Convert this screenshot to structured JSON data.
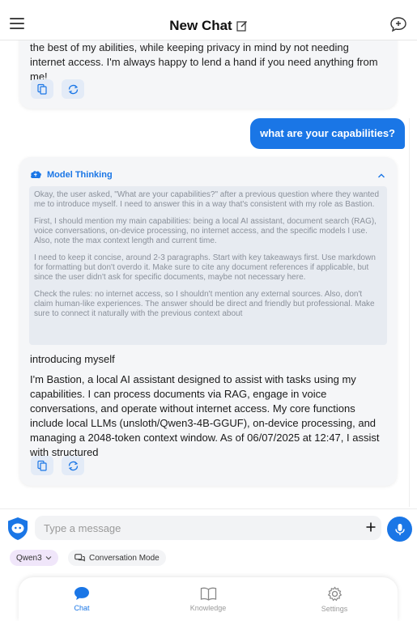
{
  "header": {
    "title": "New Chat"
  },
  "chat": {
    "previous_message": "the best of my abilities, while keeping privacy in mind by not needing internet access. I'm always happy to lend a hand if you need anything from me!",
    "user_message": "what are your capabilities?",
    "thinking": {
      "label": "Model Thinking",
      "paragraphs": [
        "Okay, the user asked, \"What are your capabilities?\" after a previous question where they wanted me to introduce myself. I need to answer this in a way that's consistent with my role as Bastion.",
        "First, I should mention my main capabilities: being a local AI assistant, document search (RAG), voice conversations, on-device processing, no internet access, and the specific models I use. Also, note the max context length and current time.",
        "I need to keep it concise, around 2-3 paragraphs. Start with key takeaways first. Use markdown for formatting but don't overdo it. Make sure to cite any document references if applicable, but since the user didn't ask for specific documents, maybe not necessary here.",
        "Check the rules: no internet access, so I shouldn't mention any external sources. Also, don't claim human-like experiences. The answer should be direct and friendly but professional. Make sure to connect it naturally with the previous context about"
      ]
    },
    "answer_title": "introducing myself",
    "answer_body": "I'm Bastion, a local AI assistant designed to assist with tasks using my capabilities. I can process documents via RAG, engage in voice conversations, and operate without internet access. My core functions include local LLMs (unsloth/Qwen3-4B-GGUF), on-device processing, and managing a 2048-token context window. As of 06/07/2025 at 12:47, I assist with structured"
  },
  "input": {
    "placeholder": "Type a message",
    "model": "Qwen3",
    "mode": "Conversation Mode"
  },
  "nav": {
    "items": [
      {
        "label": "Chat",
        "icon": "chat-bubble-icon",
        "active": true
      },
      {
        "label": "Knowledge",
        "icon": "book-icon",
        "active": false
      },
      {
        "label": "Settings",
        "icon": "gear-icon",
        "active": false
      }
    ]
  },
  "colors": {
    "accent": "#1a76e6",
    "card": "#f5f6f8",
    "thinking_box": "#e7ebf1",
    "model_pill": "#f0e6fa"
  }
}
